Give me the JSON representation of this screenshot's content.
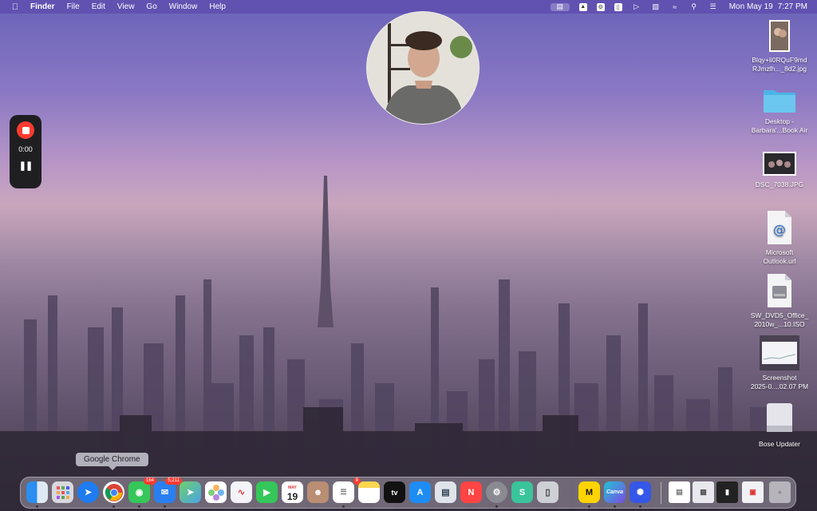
{
  "menubar": {
    "app_name": "Finder",
    "menus": [
      "File",
      "Edit",
      "View",
      "Go",
      "Window",
      "Help"
    ],
    "date": "Mon May 19",
    "time": "7:27 PM"
  },
  "recorder": {
    "elapsed": "0:00"
  },
  "desktop": {
    "items": [
      {
        "line1": "Blqy+li0RQuF9md",
        "line2": "RJmzlh..._8d2.jpg"
      },
      {
        "line1": "Desktop -",
        "line2": "Barbara'...Book Air"
      },
      {
        "line1": "DSC_7038.JPG",
        "line2": ""
      },
      {
        "line1": "Microsoft",
        "line2": "Outlook.url"
      },
      {
        "line1": "SW_DVD5_Office_",
        "line2": "2010w_...10.ISO"
      },
      {
        "line1": "Screenshot",
        "line2": "2025-0....02.07 PM"
      },
      {
        "line1": "Bose Updater",
        "line2": ""
      }
    ]
  },
  "dock": {
    "tooltip": "Google Chrome",
    "badges": {
      "messages": "164",
      "mail": "5,211",
      "reminders": "9"
    },
    "calendar_month": "MAY",
    "calendar_day": "19",
    "tv_label": "tv",
    "canva_label": "Canva"
  },
  "colors": {
    "menubar": "#5f4eaf",
    "record_red": "#ff3b30"
  }
}
